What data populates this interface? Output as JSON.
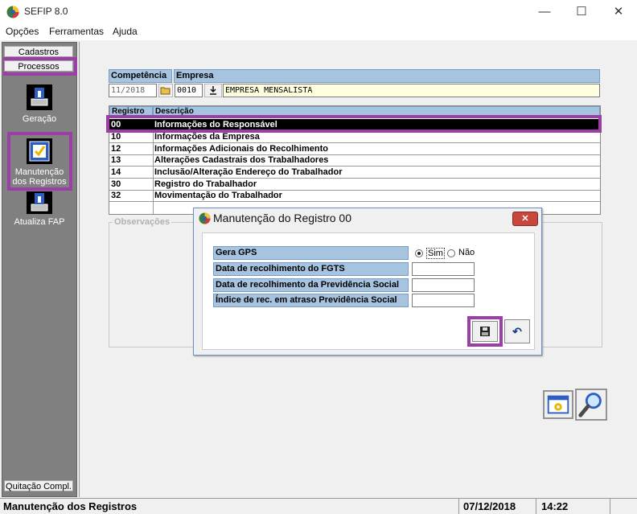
{
  "window": {
    "title": "SEFIP 8.0",
    "minimize_glyph": "—",
    "maximize_glyph": "☐",
    "close_glyph": "✕"
  },
  "menu": [
    "Opções",
    "Ferramentas",
    "Ajuda"
  ],
  "left_panel": {
    "cadastros": "Cadastros",
    "processos": "Processos",
    "items": [
      {
        "label": "Geração",
        "icon": "generation-icon"
      },
      {
        "label_line1": "Manutenção",
        "label_line2": "dos Registros",
        "icon": "maintenance-icon"
      },
      {
        "label": "Atualiza FAP",
        "icon": "update-fap-icon"
      }
    ],
    "quitacao": "Quitação Compl."
  },
  "header": {
    "competencia_label": "Competência",
    "empresa_label": "Empresa",
    "competencia_value": "11/2018",
    "empresa_code": "0010",
    "empresa_name": "EMPRESA MENSALISTA"
  },
  "register_list": {
    "col_registro": "Registro",
    "col_descricao": "Descrição",
    "rows": [
      {
        "code": "00",
        "desc": "Informações do Responsável",
        "selected": true
      },
      {
        "code": "10",
        "desc": "Informações da Empresa"
      },
      {
        "code": "12",
        "desc": "Informações Adicionais do Recolhimento"
      },
      {
        "code": "13",
        "desc": "Alterações Cadastrais dos Trabalhadores"
      },
      {
        "code": "14",
        "desc": "Inclusão/Alteração Endereço do Trabalhador"
      },
      {
        "code": "30",
        "desc": "Registro do Trabalhador"
      },
      {
        "code": "32",
        "desc": "Movimentação do Trabalhador"
      }
    ]
  },
  "observacoes_label": "Observações",
  "dialog": {
    "title": "Manutenção do Registro 00",
    "close_glyph": "✕",
    "gera_gps_label": "Gera GPS",
    "sim_label": "Sim",
    "nao_label": "Não",
    "fields": [
      "Data de recolhimento do FGTS",
      "Data de recolhimento da Previdência Social",
      "Índice de rec. em atraso Previdência Social"
    ],
    "undo_glyph": "↶"
  },
  "status": {
    "text": "Manutenção dos Registros",
    "date": "07/12/2018",
    "time": "14:22"
  },
  "colors": {
    "highlight": "#9b3fa6",
    "header_blue": "#a6c4e0",
    "selected_row": "#000000"
  }
}
